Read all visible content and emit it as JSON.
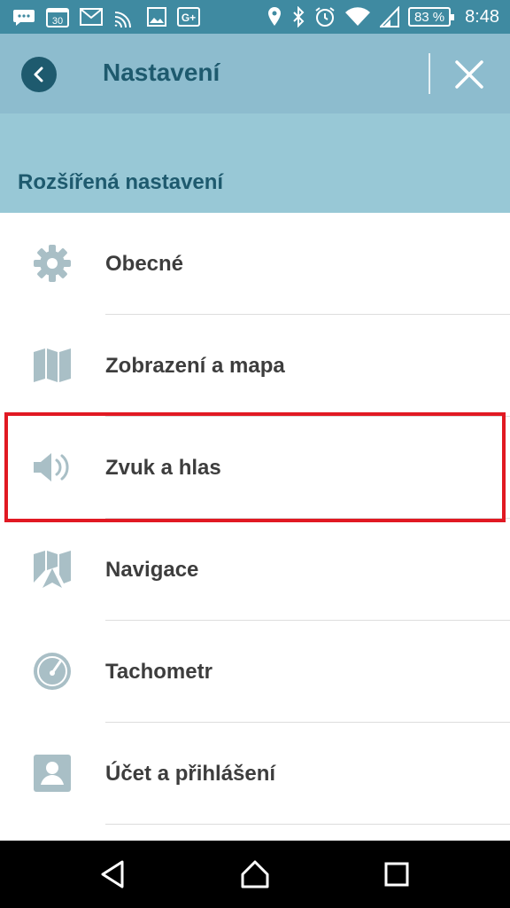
{
  "status_bar": {
    "icons_left": [
      "chat-icon",
      "calendar-icon",
      "gmail-icon",
      "cast-icon",
      "image-icon",
      "google-plus-icon"
    ],
    "calendar_day": "30",
    "gplus_text": "G+",
    "icons_right": [
      "location-icon",
      "bluetooth-icon",
      "alarm-icon",
      "wifi-icon",
      "signal-icon"
    ],
    "battery": "83 %",
    "time": "8:48"
  },
  "app_bar": {
    "title": "Nastavení"
  },
  "section": {
    "title": "Rozšířená nastavení"
  },
  "menu": [
    {
      "label": "Obecné",
      "icon": "gear-icon"
    },
    {
      "label": "Zobrazení a mapa",
      "icon": "map-icon"
    },
    {
      "label": "Zvuk a hlas",
      "icon": "speaker-icon"
    },
    {
      "label": "Navigace",
      "icon": "navigation-icon"
    },
    {
      "label": "Tachometr",
      "icon": "speedometer-icon"
    },
    {
      "label": "Účet a přihlášení",
      "icon": "account-icon"
    }
  ],
  "colors": {
    "status_bar": "#3f8aa1",
    "app_bar": "#8dbcce",
    "section_header": "#98c8d6",
    "accent_dark": "#1e5a6e",
    "icon_gray": "#a9bfc6",
    "highlight": "#e11923"
  },
  "nav_bar": {
    "buttons": [
      "back-triangle-icon",
      "home-icon",
      "recents-icon"
    ]
  }
}
